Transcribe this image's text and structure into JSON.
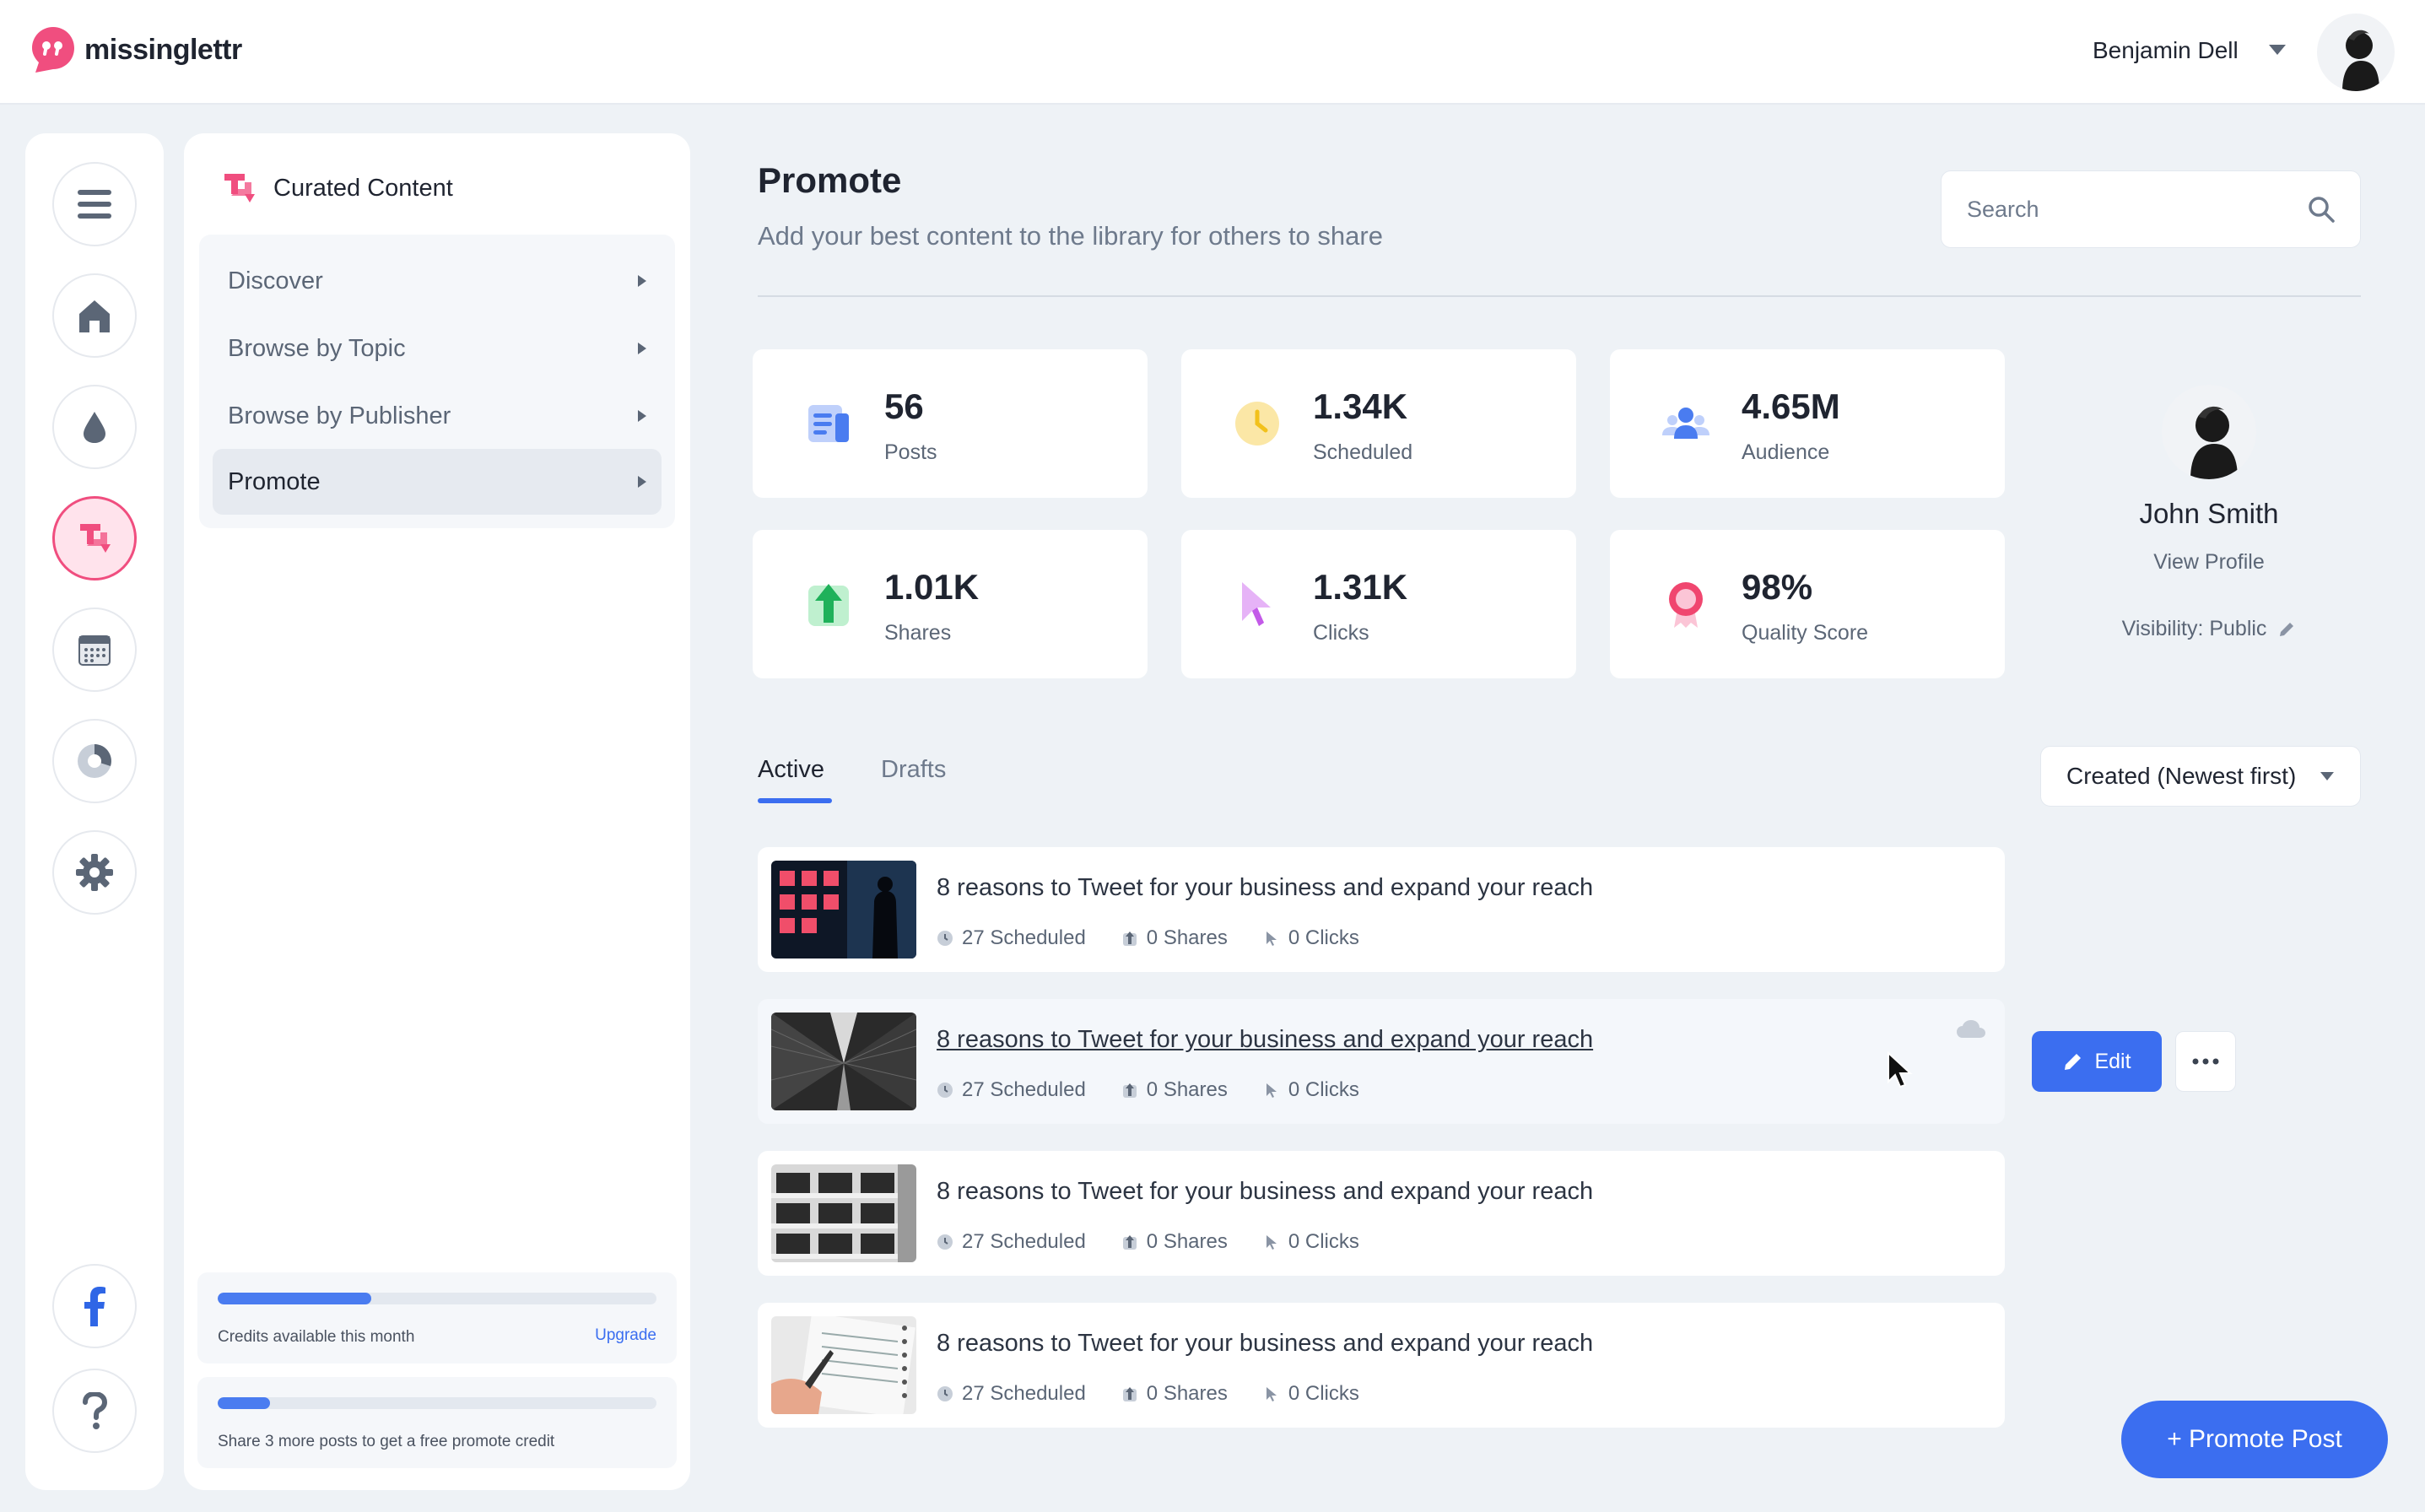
{
  "app": {
    "name": "missinglettr"
  },
  "user": {
    "name": "Benjamin Dell"
  },
  "panel": {
    "title": "Curated Content",
    "menu": [
      {
        "label": "Discover"
      },
      {
        "label": "Browse by Topic"
      },
      {
        "label": "Browse by Publisher"
      },
      {
        "label": "Promote",
        "active": true
      }
    ],
    "credits": {
      "label": "Credits available this month",
      "link": "Upgrade",
      "progress": 0.35
    },
    "share": {
      "label": "Share 3 more posts to get a free promote credit",
      "progress": 0.12
    }
  },
  "rail": {
    "icons": [
      "menu-icon",
      "home-icon",
      "drop-icon",
      "curated-icon",
      "calendar-icon",
      "analytics-icon",
      "settings-icon",
      "facebook-icon",
      "help-icon"
    ]
  },
  "header": {
    "title": "Promote",
    "subtitle": "Add your best content to the library for others to share",
    "search_placeholder": "Search"
  },
  "stats": [
    {
      "value": "56",
      "label": "Posts",
      "icon": "posts-icon"
    },
    {
      "value": "1.34K",
      "label": "Scheduled",
      "icon": "clock-icon"
    },
    {
      "value": "4.65M",
      "label": "Audience",
      "icon": "audience-icon"
    },
    {
      "value": "1.01K",
      "label": "Shares",
      "icon": "shares-icon"
    },
    {
      "value": "1.31K",
      "label": "Clicks",
      "icon": "cursor-icon"
    },
    {
      "value": "98%",
      "label": "Quality Score",
      "icon": "award-icon"
    }
  ],
  "profile": {
    "name": "John Smith",
    "link": "View Profile",
    "visibility": "Visibility: Public"
  },
  "tabs": [
    {
      "label": "Active"
    },
    {
      "label": "Drafts"
    }
  ],
  "sort": {
    "label": "Created (Newest first)"
  },
  "posts": [
    {
      "title": "8 reasons to Tweet for your business and expand your reach",
      "scheduled": "27 Scheduled",
      "shares": "0 Shares",
      "clicks": "0 Clicks"
    },
    {
      "title": "8 reasons to Tweet for your business and expand your reach",
      "scheduled": "27 Scheduled",
      "shares": "0 Shares",
      "clicks": "0 Clicks"
    },
    {
      "title": "8 reasons to Tweet for your business and expand your reach",
      "scheduled": "27 Scheduled",
      "shares": "0 Shares",
      "clicks": "0 Clicks"
    },
    {
      "title": "8 reasons to Tweet for your business and expand your reach",
      "scheduled": "27 Scheduled",
      "shares": "0 Shares",
      "clicks": "0 Clicks"
    }
  ],
  "actions": {
    "edit": "Edit",
    "promote": "+ Promote Post"
  },
  "colors": {
    "accent": "#3b6ef0",
    "brand": "#f04e7f"
  }
}
